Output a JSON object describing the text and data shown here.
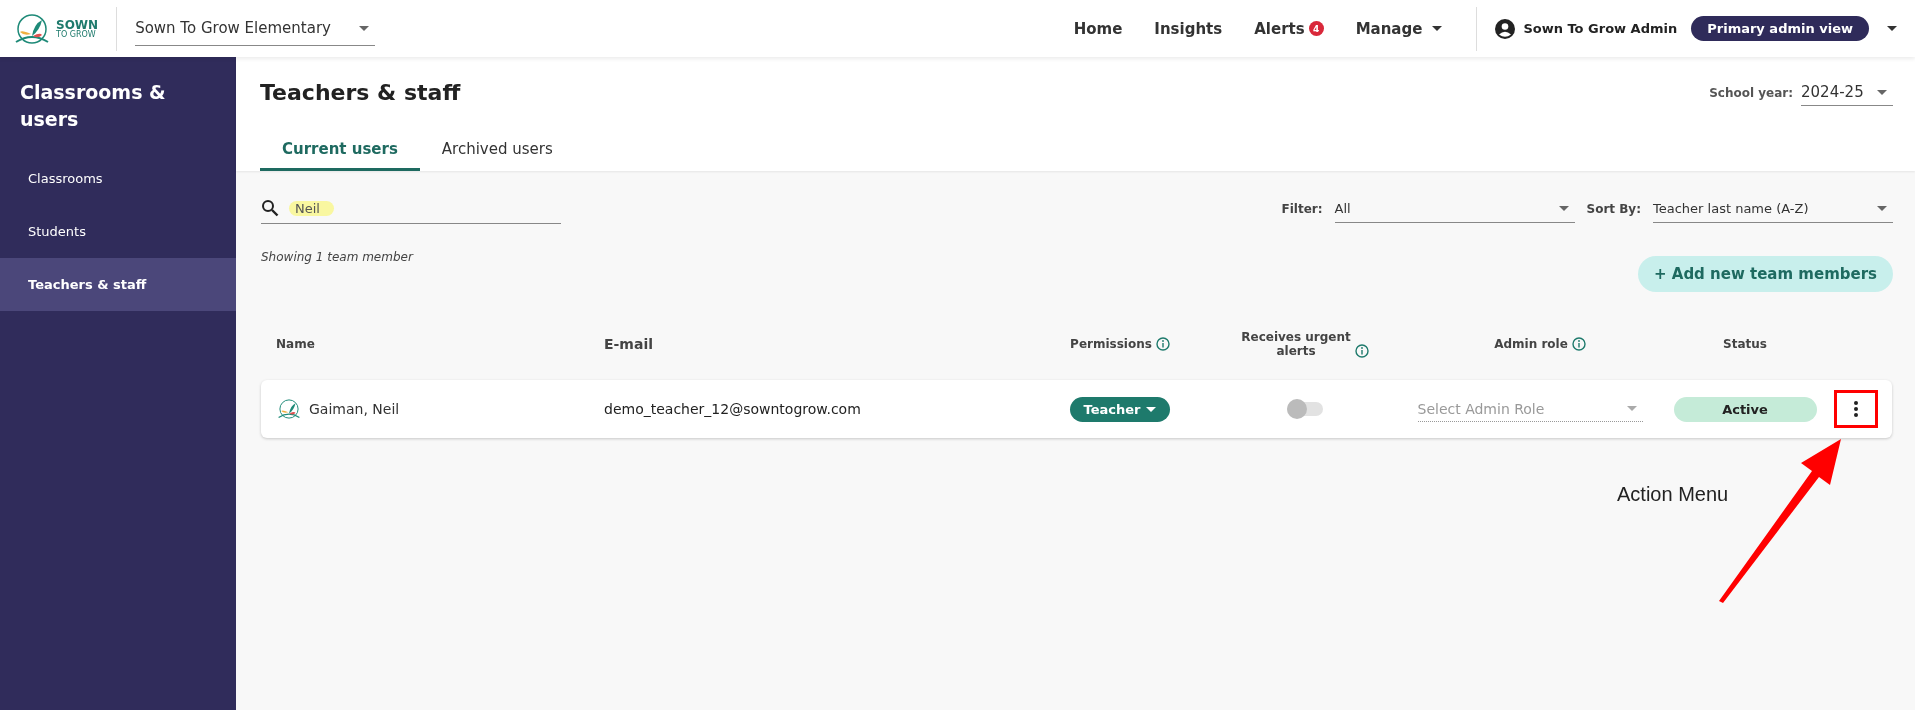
{
  "header": {
    "logo": {
      "line1": "SOWN",
      "line2": "TO GROW"
    },
    "school": "Sown To Grow Elementary",
    "nav": [
      {
        "label": "Home",
        "caret": false
      },
      {
        "label": "Insights",
        "caret": false
      },
      {
        "label": "Alerts",
        "badge": "4",
        "caret": false
      },
      {
        "label": "Manage",
        "caret": true
      }
    ],
    "user": "Sown To Grow Admin",
    "view_button": "Primary admin view"
  },
  "sidebar": {
    "title": "Classrooms & users",
    "items": [
      {
        "label": "Classrooms",
        "selected": false
      },
      {
        "label": "Students",
        "selected": false
      },
      {
        "label": "Teachers & staff",
        "selected": true
      }
    ]
  },
  "page": {
    "title": "Teachers & staff",
    "school_year_label": "School year:",
    "school_year": "2024-25",
    "tabs": [
      {
        "label": "Current users",
        "selected": true
      },
      {
        "label": "Archived users",
        "selected": false
      }
    ],
    "search": {
      "value": "Neil"
    },
    "filter": {
      "label": "Filter:",
      "value": "All"
    },
    "sort": {
      "label": "Sort By:",
      "value": "Teacher last name (A-Z)"
    },
    "count": "Showing 1 team member",
    "add_button": "+ Add new team members"
  },
  "table": {
    "columns": [
      {
        "label": "Name",
        "info": false
      },
      {
        "label": "E-mail",
        "info": false
      },
      {
        "label": "Permissions",
        "info": true
      },
      {
        "label": "Receives urgent alerts",
        "info": true
      },
      {
        "label": "Admin role",
        "info": true
      },
      {
        "label": "Status",
        "info": false
      }
    ],
    "rows": [
      {
        "name": "Gaiman, Neil",
        "email": "demo_teacher_12@sowntogrow.com",
        "permission": "Teacher",
        "urgent_alerts": false,
        "admin_role_placeholder": "Select Admin Role",
        "status": "Active"
      }
    ]
  },
  "annotation": {
    "label": "Action Menu"
  }
}
